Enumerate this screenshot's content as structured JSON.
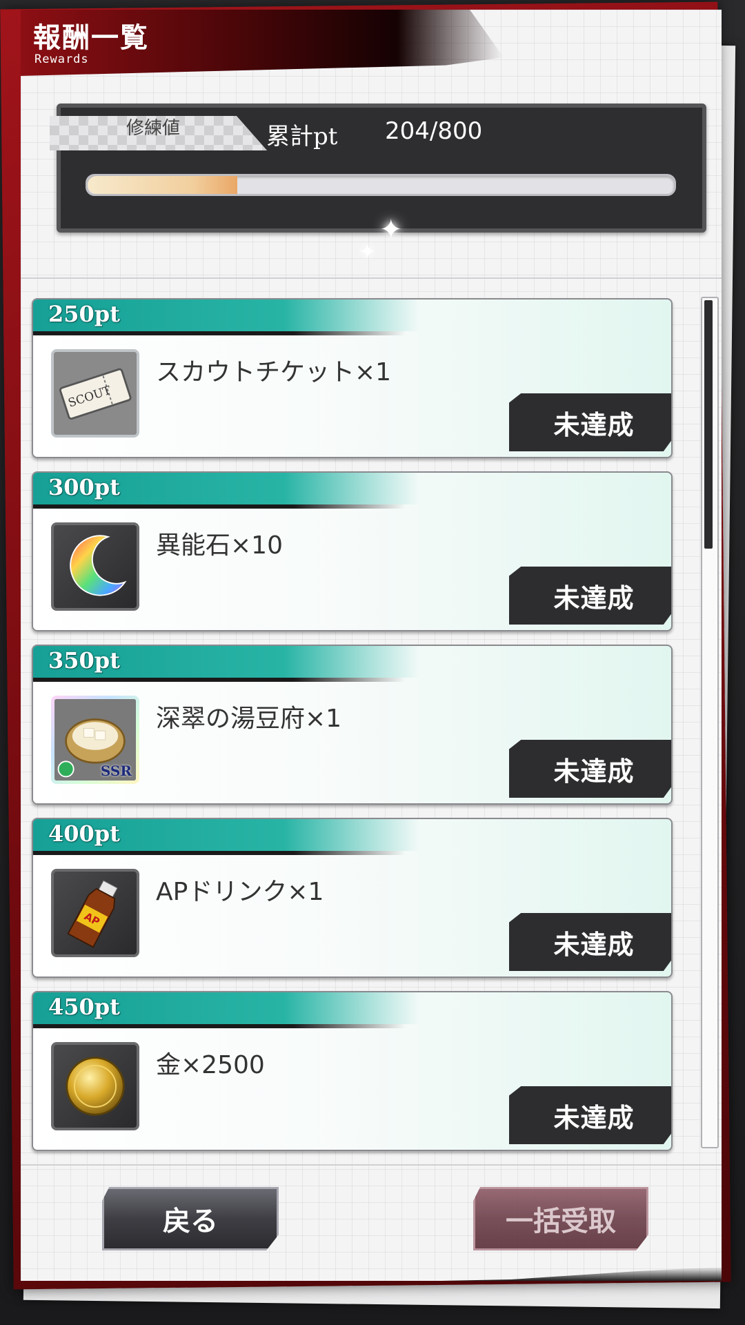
{
  "header": {
    "title": "報酬一覧",
    "subtitle": "Rewards"
  },
  "progress": {
    "tag_label": "修練値",
    "total_label": "累計pt",
    "total_value": "204/800",
    "fraction": 0.255
  },
  "rewards": [
    {
      "points": "250pt",
      "name": "スカウトチケット×1",
      "status": "未達成",
      "icon": "scout-ticket-icon"
    },
    {
      "points": "300pt",
      "name": "異能石×10",
      "status": "未達成",
      "icon": "crescent-stone-icon"
    },
    {
      "points": "350pt",
      "name": "深翠の湯豆府×1",
      "status": "未達成",
      "icon": "tofu-pot-icon",
      "badge": "SSR"
    },
    {
      "points": "400pt",
      "name": "APドリンク×1",
      "status": "未達成",
      "icon": "ap-drink-icon"
    },
    {
      "points": "450pt",
      "name": "金×2500",
      "status": "未達成",
      "icon": "gold-coin-icon"
    }
  ],
  "footer": {
    "back_label": "戻る",
    "bulk_label": "一括受取"
  },
  "colors": {
    "accent_teal": "#1aa096",
    "frame_red": "#a0141a",
    "button_dark": "#2d2d2f"
  }
}
